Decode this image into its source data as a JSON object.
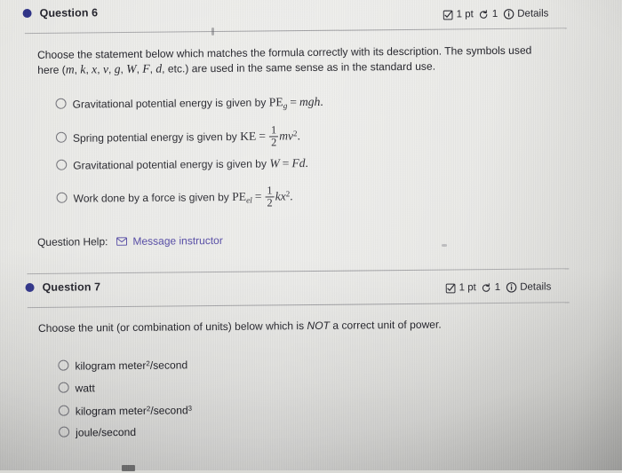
{
  "page": {
    "bullet_color": "#2b2f86",
    "link_color": "#4a3fa0"
  },
  "questions": [
    {
      "title": "Question 6",
      "points": "1 pt",
      "attempts": "1",
      "details_label": "Details",
      "prompt_line1": "Choose the statement below which matches the formula correctly with its description. The symbols used",
      "prompt_line2_pre": "here (",
      "prompt_symbols": [
        "m",
        "k",
        "x",
        "v",
        "g",
        "W",
        "F",
        "d"
      ],
      "prompt_line2_post": ", etc.) are used in the same sense as in the standard use.",
      "options": [
        {
          "text_before": "Gravitational potential energy is given by",
          "formula": "PE_g = mgh",
          "trailing": "."
        },
        {
          "text_before": "Spring potential energy is given by",
          "formula": "KE = 1/2 mv^2",
          "trailing": "."
        },
        {
          "text_before": "Gravitational potential energy is given by",
          "formula": "W = Fd",
          "trailing": "."
        },
        {
          "text_before": "Work done by a force is given by",
          "formula": "PE_el = 1/2 kx^2",
          "trailing": "."
        }
      ],
      "help_label": "Question Help:",
      "help_link": "Message instructor"
    },
    {
      "title": "Question 7",
      "points": "1 pt",
      "attempts": "1",
      "details_label": "Details",
      "prompt_pre": "Choose the unit (or combination of units) below which is ",
      "prompt_emphasis": "NOT",
      "prompt_post": " a correct unit of power.",
      "options": [
        {
          "parts": [
            "kilogram meter",
            "2",
            "/second",
            ""
          ]
        },
        {
          "parts": [
            "watt",
            "",
            "",
            ""
          ]
        },
        {
          "parts": [
            "kilogram meter",
            "2",
            "/second",
            "3"
          ]
        },
        {
          "parts": [
            "joule/second",
            "",
            "",
            ""
          ]
        }
      ]
    }
  ],
  "math": {
    "PE": "PE",
    "g_sub": "g",
    "el_sub": "el",
    "eq": "=",
    "mgh": "mgh",
    "KE": "KE",
    "one": "1",
    "two": "2",
    "mv": "mv",
    "sq": "2",
    "W": "W",
    "Fd": "Fd",
    "kx": "kx",
    "period": "."
  }
}
